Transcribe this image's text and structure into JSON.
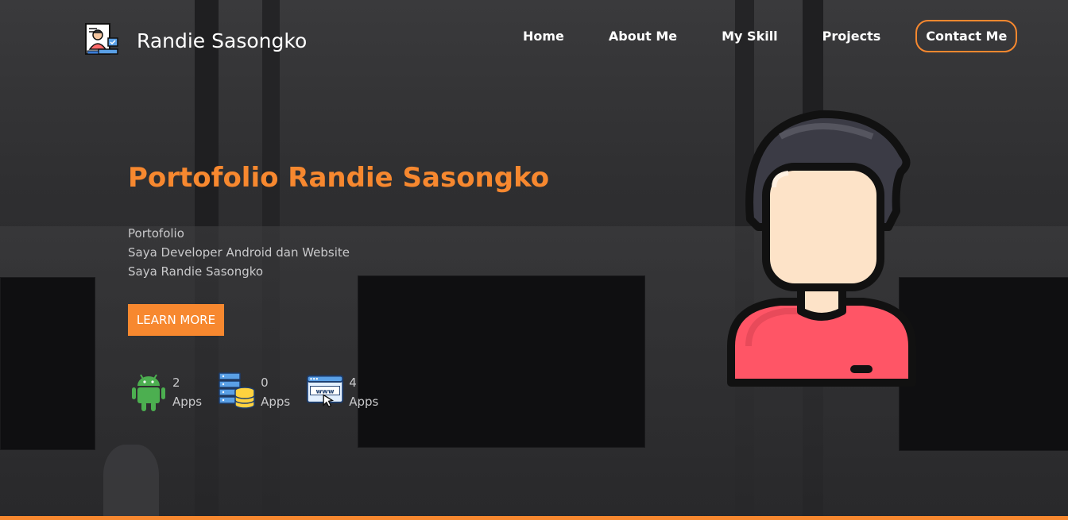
{
  "brand": {
    "name": "Randie Sasongko",
    "logo_icon": "developer-avatar-icon"
  },
  "nav": {
    "items": [
      {
        "label": "Home"
      },
      {
        "label": "About Me"
      },
      {
        "label": "My Skill"
      },
      {
        "label": "Projects"
      },
      {
        "label": "Contact Me"
      }
    ]
  },
  "hero": {
    "title": "Portofolio Randie Sasongko",
    "lines": [
      "Portofolio",
      "Saya Developer Android dan Website",
      "Saya Randie Sasongko"
    ],
    "cta_label": "LEARN MORE",
    "illustration": "person-avatar-icon"
  },
  "stats": [
    {
      "icon": "android-icon",
      "count": "2",
      "label": "Apps"
    },
    {
      "icon": "database-server-icon",
      "count": "0",
      "label": "Apps"
    },
    {
      "icon": "www-browser-icon",
      "count": "4",
      "label": "Apps"
    }
  ],
  "colors": {
    "accent": "#f7882f",
    "background": "#2f2f31",
    "text_primary": "#ffffff",
    "text_muted": "#c9c9cb"
  }
}
